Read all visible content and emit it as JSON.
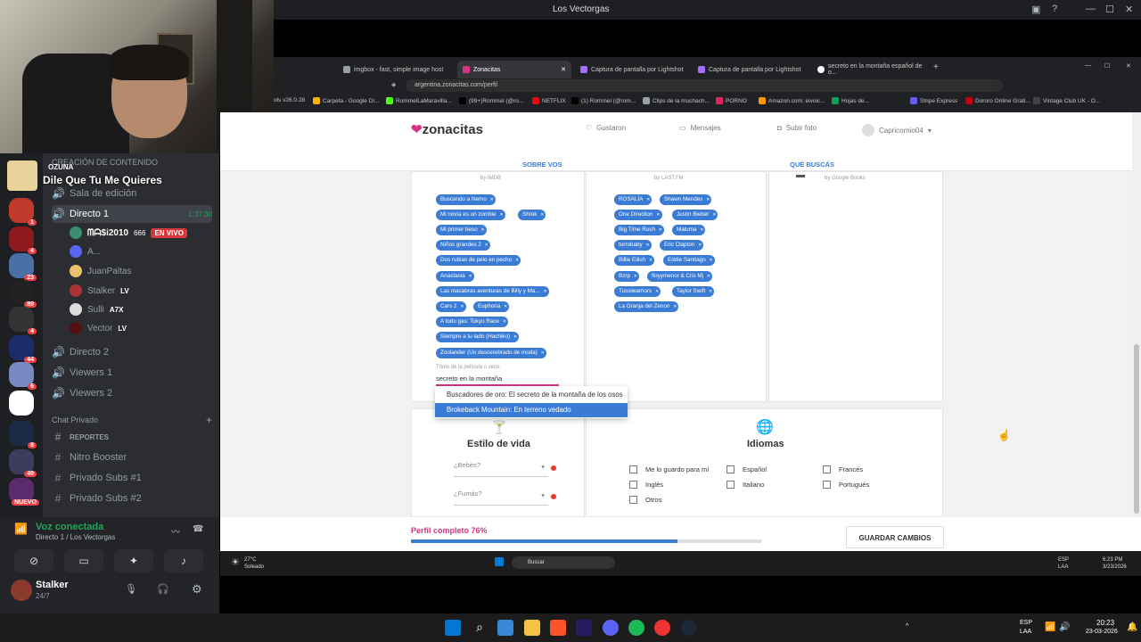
{
  "window": {
    "title": "Los Vectorgas"
  },
  "song": {
    "artist": "OZUNA",
    "title": "Dile Que Tu Me Quieres"
  },
  "discord": {
    "category_top": "CREACIÓN DE CONTENIDO",
    "channels": [
      {
        "label": "Sala de edición"
      },
      {
        "label": "Directo 1",
        "time": "1:37:30"
      },
      {
        "label": "Directo 2"
      },
      {
        "label": "Viewers 1"
      },
      {
        "label": "Viewers 2"
      }
    ],
    "voice_users": [
      {
        "name": "ᗰᗩ$i2010",
        "extra": "666",
        "live": "EN VIVO"
      },
      {
        "name": "A..."
      },
      {
        "name": "JuanPaltas"
      },
      {
        "name": "Stalker",
        "tag": "LV"
      },
      {
        "name": "Sulli",
        "tag": "A7X"
      },
      {
        "name": "Vector",
        "tag": "LV"
      }
    ],
    "private_category": "Chat Privado",
    "text_channels": [
      "REPORTES",
      "Nitro Booster",
      "Privado Subs #1",
      "Privado Subs #2"
    ],
    "guild_badges": [
      "1",
      "4",
      "23",
      "89",
      "4",
      "44",
      "6",
      "8",
      "49",
      "NUEVO"
    ],
    "voice_status": {
      "label": "Voz conectada",
      "sub": "Directo 1 / Los Vectorgas"
    },
    "user": {
      "name": "Stalker",
      "status": "24/7"
    }
  },
  "browser": {
    "tabs": [
      "imgbox - fast, simple image host",
      "Zonacitas",
      "Captura de pantalla por Lightshot",
      "Captura de pantalla por Lightshot",
      "secreto en la montaña español de o..."
    ],
    "url": "argentina.zonacitas.com/perfil",
    "bookmarks": [
      "ols v26.0.28",
      "Carpeta - Google Dr...",
      "RommelLaMaravilla...",
      "(99+)Rommel (@ro...",
      "NETFLIX",
      "(1) Rommel (@rom...",
      "Clips de la muchach...",
      "PORNO",
      "Amazon.com: eivoic...",
      "Stripe Express",
      "Hojas de...",
      "Dororo Online Grati...",
      "Vintage Club UK - O..."
    ]
  },
  "site": {
    "logo": "zonacitas",
    "nav": {
      "likes": "Gustaron",
      "messages": "Mensajes",
      "upload": "Subir foto",
      "user": "Capricornio04"
    },
    "subtabs": {
      "about": "SOBRE VOS",
      "seeking": "QUÉ BUSCÁS"
    },
    "movies": {
      "source": "by IMDB",
      "tags": [
        "Buscando a Nemo",
        "Mi novia es un zombie",
        "Shrek",
        "Mi primer beso",
        "Niños grandes 2",
        "Dos rubias de pelo en pecho",
        "Anastasia",
        "Las macabras aventuras de Billy y Ma...",
        "Cars 2",
        "Euphoria",
        "A todo gas: Tokyo Race",
        "Siempre a tu lado (Hachiko)",
        "Zoolander (Un descerebrado de moda)"
      ],
      "input_label": "Título de la película o serie",
      "input_value": "secreto en la montaña",
      "suggestions": [
        "Buscadores de oro: El secreto de la montaña de los osos",
        "Brokeback Mountain: En terreno vedado"
      ]
    },
    "music": {
      "source": "by LAST.FM",
      "tags": [
        "ROSALÍA",
        "Shawn Mendes",
        "One Direction",
        "Justin Bieber",
        "Big Time Rush",
        "Maluma",
        "turrobaby",
        "Eric Clapton",
        "Billie Eilish",
        "Eddie Santiago",
        "Bzrp",
        "floyymenor & Cris Mj",
        "Tussiwarriors",
        "Taylor Swift",
        "La Granja del Zenon"
      ]
    },
    "books": {
      "source": "by Google Books"
    },
    "lifestyle": {
      "title": "Estilo de vida",
      "drink": "¿Bebés?",
      "smoke": "¿Fumás?"
    },
    "languages": {
      "title": "Idiomas",
      "options": [
        "Me lo guardo para mí",
        "Español",
        "Francés",
        "Inglés",
        "Italiano",
        "Portugués",
        "Otros"
      ]
    },
    "progress": {
      "label": "Perfil completo 76%",
      "value": 0.76
    },
    "save": "GUARDAR CAMBIOS"
  },
  "inner_taskbar": {
    "weather": "27°C",
    "weather_sub": "Soleado",
    "search": "Buscar",
    "lang": "ESP",
    "lang2": "LAA",
    "time": "6:23 PM",
    "date": "3/23/2026"
  },
  "taskbar": {
    "lang": "ESP",
    "lang2": "LAA",
    "time": "20:23",
    "date": "23-03-2026"
  },
  "colors": {
    "accent": "#3a7bd5",
    "brand": "#d63384",
    "discord_green": "#23a55a",
    "live_red": "#da373c"
  }
}
